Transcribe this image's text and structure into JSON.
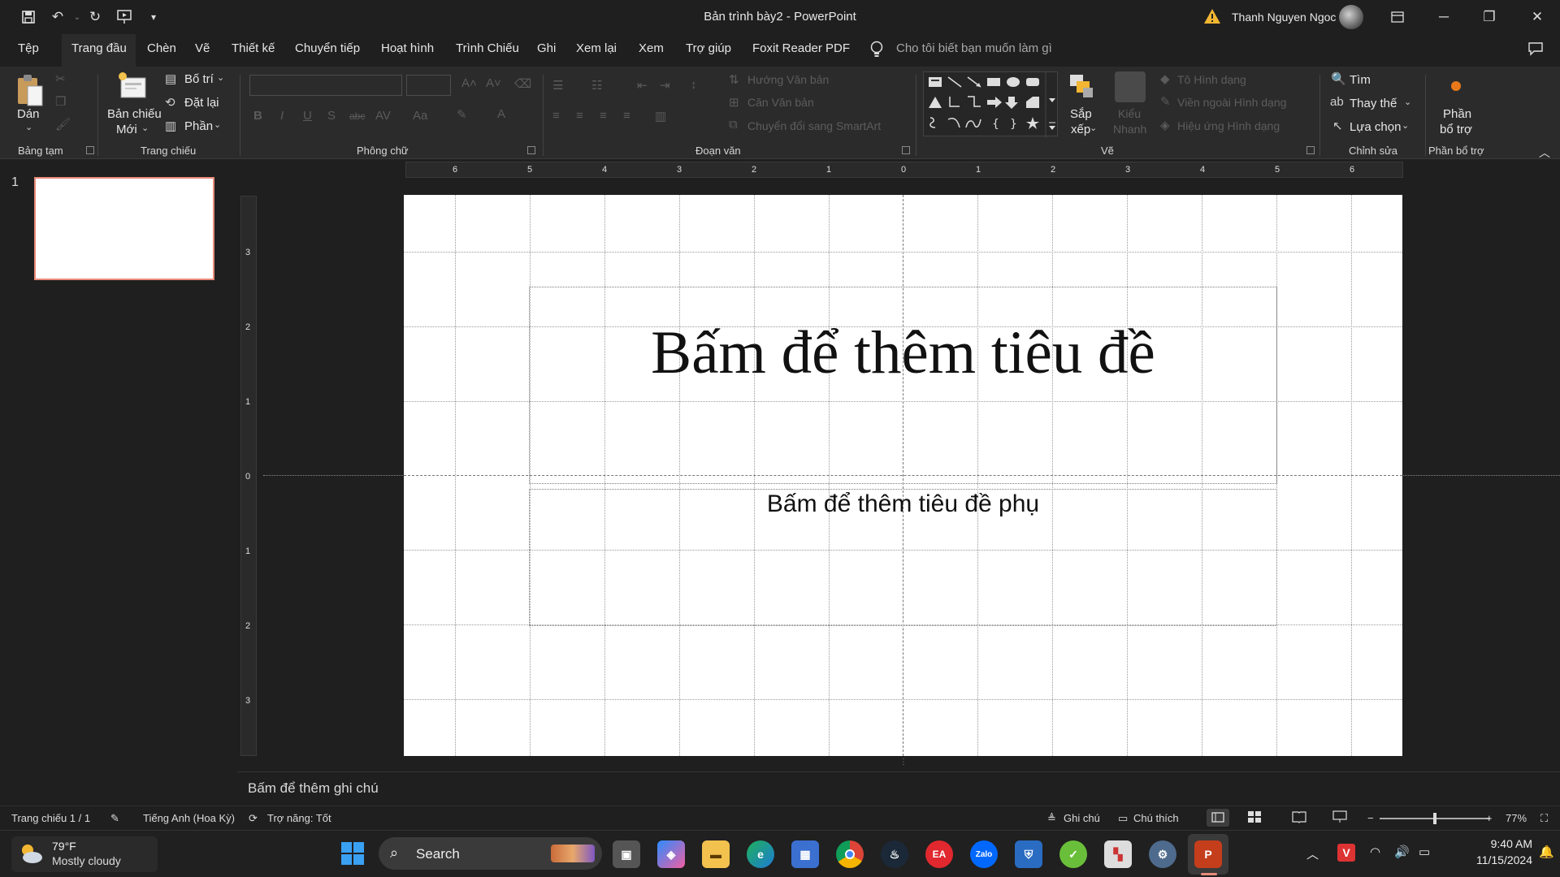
{
  "window": {
    "title": "Bản trình bày2  -  PowerPoint",
    "user": "Thanh Nguyen Ngoc"
  },
  "menu": [
    "Tệp",
    "Trang đầu",
    "Chèn",
    "Vẽ",
    "Thiết kế",
    "Chuyển tiếp",
    "Hoạt hình",
    "Trình Chiếu",
    "Ghi",
    "Xem lại",
    "Xem",
    "Trợ giúp",
    "Foxit Reader PDF"
  ],
  "menu_active": "Trang đầu",
  "tellme": "Cho tôi biết bạn muốn làm gì",
  "ribbon": {
    "clipboard": {
      "paste": "Dán",
      "group": "Bảng tạm"
    },
    "slides": {
      "new_l1": "Bản chiếu",
      "new_l2": "Mới",
      "layout": "Bố trí",
      "reset": "Đặt lại",
      "section": "Phần",
      "group": "Trang chiếu"
    },
    "font": {
      "group": "Phông chữ"
    },
    "paragraph": {
      "text_direction": "Hướng Văn bản",
      "align_text": "Căn Văn bản",
      "smartart": "Chuyển đổi sang SmartArt",
      "group": "Đoạn văn"
    },
    "drawing": {
      "arrange_l1": "Sắp",
      "arrange_l2": "xếp",
      "quick_l1": "Kiểu",
      "quick_l2": "Nhanh",
      "fill": "Tô Hình dạng",
      "outline": "Viền ngoài Hình dạng",
      "effects": "Hiệu ứng Hình dạng",
      "group": "Vẽ"
    },
    "editing": {
      "find": "Tìm",
      "replace": "Thay thế",
      "select": "Lựa chọn",
      "group": "Chỉnh sửa"
    },
    "addins": {
      "label_l1": "Phần",
      "label_l2": "bổ trợ",
      "group": "Phần bổ trợ"
    }
  },
  "thumbs": {
    "number": "1"
  },
  "ruler": {
    "h": [
      "6",
      "5",
      "4",
      "3",
      "2",
      "1",
      "0",
      "1",
      "2",
      "3",
      "4",
      "5",
      "6"
    ],
    "v": [
      "3",
      "2",
      "1",
      "0",
      "1",
      "2",
      "3"
    ]
  },
  "slide": {
    "title": "Bấm để thêm tiêu đề",
    "subtitle": "Bấm để thêm tiêu đề phụ"
  },
  "notes_placeholder": "Bấm để thêm ghi chú",
  "status": {
    "slide": "Trang chiếu 1 / 1",
    "language": "Tiếng Anh (Hoa Kỳ)",
    "accessibility": "Trợ năng: Tốt",
    "notes": "Ghi chú",
    "comments": "Chú thích",
    "zoom": "77%"
  },
  "zoom_fraction": 0.5,
  "taskbar": {
    "weather_temp": "79°F",
    "weather_desc": "Mostly cloudy",
    "search": "Search",
    "time": "9:40 AM",
    "date": "11/15/2024"
  },
  "colors": {
    "accent": "#e98a7a",
    "powerpoint": "#c43e1c"
  }
}
